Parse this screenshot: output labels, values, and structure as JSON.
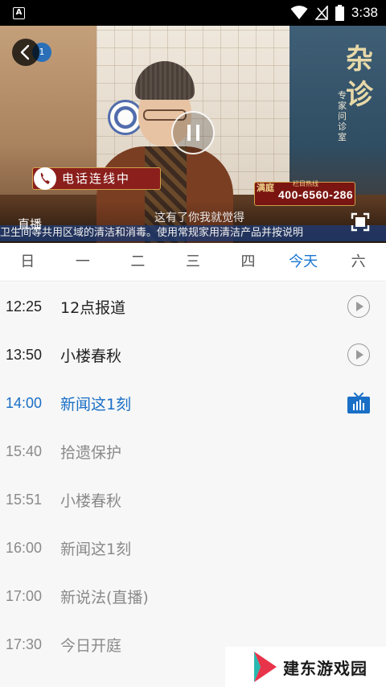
{
  "status_bar": {
    "time": "3:38",
    "app_icon": "A",
    "icons": [
      "wifi-icon",
      "no-signal-icon",
      "battery-icon"
    ]
  },
  "player": {
    "live_label": "直播",
    "subtitle": "这有了你我就觉得",
    "ticker": "卫生间等共用区域的清洁和消毒。使用常规家用清洁产品并按说明",
    "call_banner": "电话连线中",
    "hotline_label": "栏目热线",
    "hotline_number": "400-6560-286",
    "hotline_seal": "满庭",
    "show_title": "杂诊",
    "show_tagline": "专家问诊室"
  },
  "days": {
    "tabs": [
      "日",
      "一",
      "二",
      "三",
      "四",
      "今天",
      "六"
    ],
    "active_index": 5,
    "active_color": "#1976d2"
  },
  "schedule": [
    {
      "time": "12:25",
      "title": "12点报道",
      "state": "past",
      "icon": "play-circle-icon"
    },
    {
      "time": "13:50",
      "title": "小楼春秋",
      "state": "past",
      "icon": "play-circle-icon"
    },
    {
      "time": "14:00",
      "title": "新闻这1刻",
      "state": "current",
      "icon": "tv-live-icon"
    },
    {
      "time": "15:40",
      "title": "拾遗保护",
      "state": "future"
    },
    {
      "time": "15:51",
      "title": "小楼春秋",
      "state": "future"
    },
    {
      "time": "16:00",
      "title": "新闻这1刻",
      "state": "future"
    },
    {
      "time": "17:00",
      "title": "新说法(直播)",
      "state": "future"
    },
    {
      "time": "17:30",
      "title": "今日开庭",
      "state": "future"
    }
  ],
  "watermark": {
    "text": "建东游戏园"
  },
  "colors": {
    "accent": "#1976d2",
    "current_row": "#1a6fc6",
    "future_text": "#8a8a8a"
  }
}
